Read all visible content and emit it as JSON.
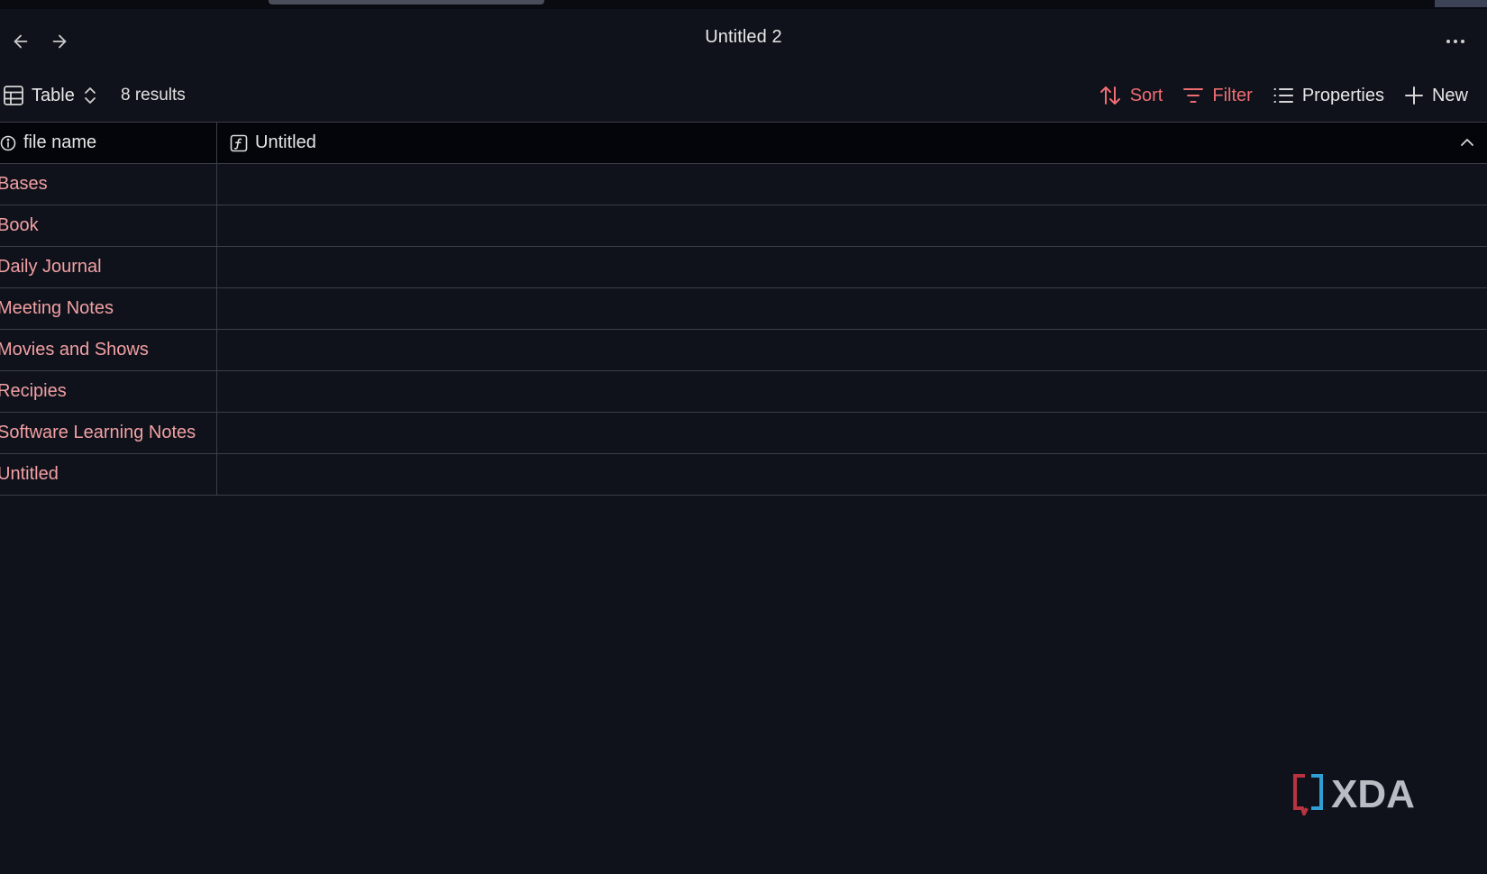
{
  "window": {
    "title": "Untitled 2"
  },
  "toolbar": {
    "view_label": "Table",
    "result_count": "8 results",
    "sort_label": "Sort",
    "filter_label": "Filter",
    "properties_label": "Properties",
    "new_label": "New"
  },
  "table": {
    "columns": [
      "file name",
      "Untitled"
    ],
    "rows": [
      {
        "file_name": "Bases",
        "untitled": ""
      },
      {
        "file_name": "Book",
        "untitled": ""
      },
      {
        "file_name": "Daily Journal",
        "untitled": ""
      },
      {
        "file_name": "Meeting Notes",
        "untitled": ""
      },
      {
        "file_name": "Movies and Shows",
        "untitled": ""
      },
      {
        "file_name": "Recipies",
        "untitled": ""
      },
      {
        "file_name": "Software Learning Notes",
        "untitled": ""
      },
      {
        "file_name": "Untitled",
        "untitled": ""
      }
    ]
  },
  "watermark": {
    "text": "XDA"
  },
  "colors": {
    "background": "#0f121b",
    "header_background": "#03050a",
    "accent": "#ee6d72",
    "link": "#f2a0a3",
    "text": "#e6e6e6",
    "divider": "#3a3e48"
  },
  "icons": {
    "back": "arrow-left-icon",
    "forward": "arrow-right-icon",
    "more": "more-horizontal-icon",
    "view": "table-icon",
    "view_switch": "chevrons-up-down-icon",
    "sort": "sort-arrows-icon",
    "filter": "filter-icon",
    "properties": "list-icon",
    "new": "plus-icon",
    "file_name_column": "info-icon",
    "untitled_column": "formula-icon",
    "collapse": "chevron-up-icon"
  }
}
